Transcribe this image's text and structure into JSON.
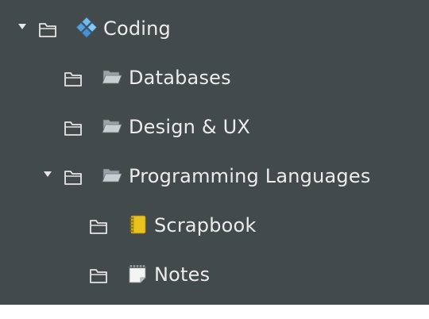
{
  "tree": {
    "colors": {
      "panel_background": "#434a4b",
      "text": "#ececec",
      "outline_icon": "#e6e6e6"
    },
    "items": [
      {
        "label": "Coding",
        "icon": "diamond-tiles-icon",
        "expanded": true,
        "has_children": true
      },
      {
        "label": "Databases",
        "icon": "open-folder-icon",
        "expanded": false,
        "has_children": false
      },
      {
        "label": "Design & UX",
        "icon": "open-folder-icon",
        "expanded": false,
        "has_children": false
      },
      {
        "label": "Programming Languages",
        "icon": "open-folder-icon",
        "expanded": true,
        "has_children": true
      },
      {
        "label": "Scrapbook",
        "icon": "notebook-icon",
        "expanded": false,
        "has_children": false
      },
      {
        "label": "Notes",
        "icon": "notepad-icon",
        "expanded": false,
        "has_children": false
      }
    ]
  }
}
